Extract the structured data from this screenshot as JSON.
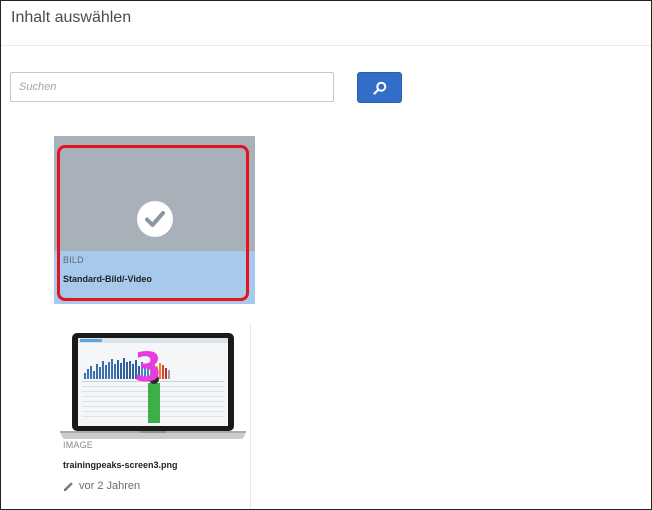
{
  "dialog": {
    "title": "Inhalt auswählen"
  },
  "search": {
    "placeholder": "Suchen",
    "value": "",
    "button_icon": "search-icon"
  },
  "cards": [
    {
      "type_label": "BILD",
      "title": "Standard-Bild/-Video",
      "selected": true,
      "icon": "checkmark-icon"
    },
    {
      "type_label": "IMAGE",
      "title": "trainingpeaks-screen3.png",
      "modified": "vor 2 Jahren",
      "overlay_number": "3",
      "icon": "pencil-icon"
    }
  ],
  "colors": {
    "accent": "#326ec8",
    "selection_outline": "#e4131f",
    "selected_meta_bg": "#a7c9ec",
    "thumb_bg": "#a8b1b9",
    "overlay_number": "#e83ae0"
  }
}
